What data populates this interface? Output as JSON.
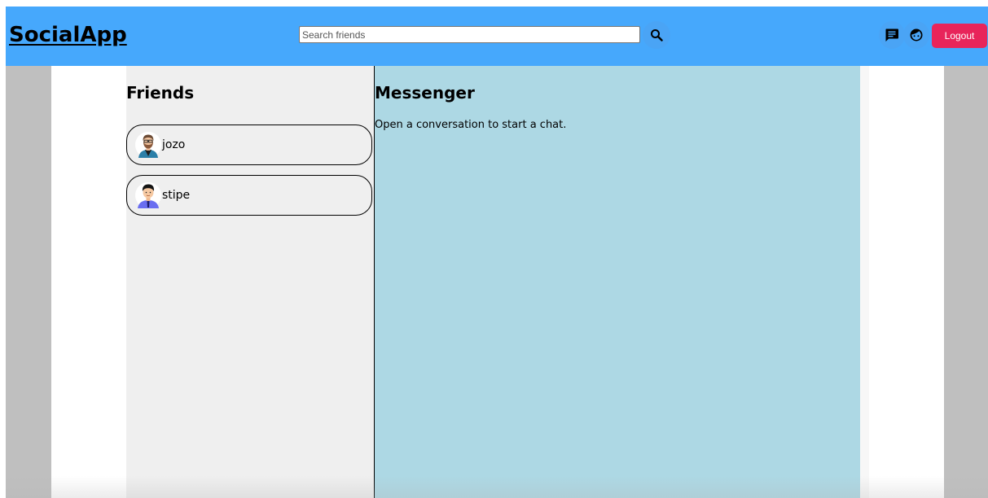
{
  "header": {
    "brand": "SocialApp",
    "search_placeholder": "Search friends",
    "search_value": "",
    "logout_label": "Logout",
    "icons": {
      "search": "search-icon",
      "messenger": "chat-icon",
      "profile": "face-icon"
    }
  },
  "friends": {
    "title": "Friends",
    "items": [
      {
        "name": "jozo",
        "avatar": "bearded-man-avatar"
      },
      {
        "name": "stipe",
        "avatar": "man-tie-avatar"
      }
    ]
  },
  "messenger": {
    "title": "Messenger",
    "hint": "Open a conversation to start a chat."
  },
  "colors": {
    "header_bg": "#46a8fc",
    "logout_bg": "#e8245a",
    "friends_bg": "#efefef",
    "messenger_bg": "#add8e4",
    "outer_bg": "#bfbfbf"
  }
}
